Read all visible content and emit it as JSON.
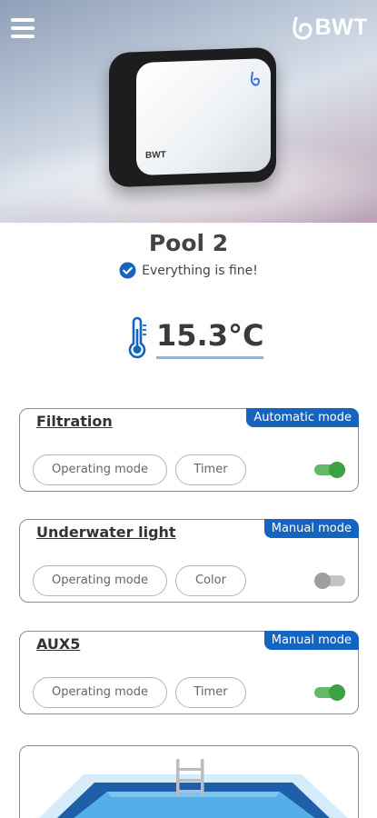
{
  "header": {
    "brand": "BWT",
    "device_label": "BWT"
  },
  "pool": {
    "name": "Pool 2",
    "status": "Everything is fine!",
    "temperature": "15.3°C"
  },
  "equipment": [
    {
      "title": "Filtration",
      "mode": "Automatic mode",
      "operating_label": "Operating mode",
      "secondary_label": "Timer",
      "enabled": true
    },
    {
      "title": "Underwater light",
      "mode": "Manual mode",
      "operating_label": "Operating mode",
      "secondary_label": "Color",
      "enabled": false
    },
    {
      "title": "AUX5",
      "mode": "Manual mode",
      "operating_label": "Operating mode",
      "secondary_label": "Timer",
      "enabled": true
    }
  ],
  "colors": {
    "accent": "#1565c0",
    "toggle_on": "#3aa33f",
    "toggle_off": "#9e9e9e"
  },
  "icons": [
    "menu-icon",
    "bwt-logo-icon",
    "check-circle-icon",
    "thermometer-icon",
    "pool-illustration"
  ]
}
